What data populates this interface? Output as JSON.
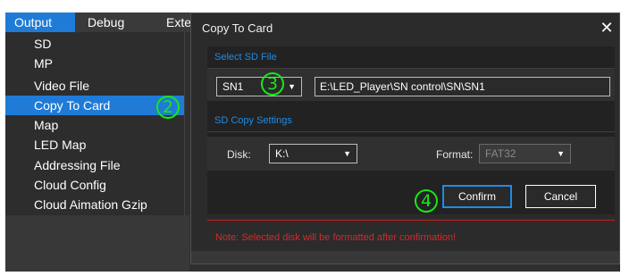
{
  "menubar": {
    "tabs": [
      {
        "label": "Output"
      },
      {
        "label": "Debug"
      },
      {
        "label": "Exte"
      }
    ]
  },
  "dropdown": {
    "items": [
      {
        "label": "SD"
      },
      {
        "label": "MP"
      },
      {
        "label": "Video File"
      },
      {
        "label": "Copy To Card"
      },
      {
        "label": "Map"
      },
      {
        "label": "LED Map"
      },
      {
        "label": "Addressing File"
      },
      {
        "label": "Cloud Config"
      },
      {
        "label": "Cloud Aimation Gzip"
      }
    ]
  },
  "callouts": {
    "c2": "2",
    "c3": "3",
    "c4": "4"
  },
  "dialog": {
    "title": "Copy To Card",
    "close": "✕",
    "select_section": "Select SD File",
    "sn_value": "SN1",
    "path_value": "E:\\LED_Player\\SN control\\SN\\SN1",
    "copy_section": "SD Copy Settings",
    "disk_label": "Disk:",
    "disk_value": "K:\\",
    "format_label": "Format:",
    "format_value": "FAT32",
    "confirm_label": "Confirm",
    "cancel_label": "Cancel",
    "note": "Note: Selected disk will be formatted after confirmation!"
  },
  "colors": {
    "accent": "#1f7bd6",
    "callout": "#19e619",
    "section": "#1e8ce6",
    "warning": "#d42a2a"
  }
}
